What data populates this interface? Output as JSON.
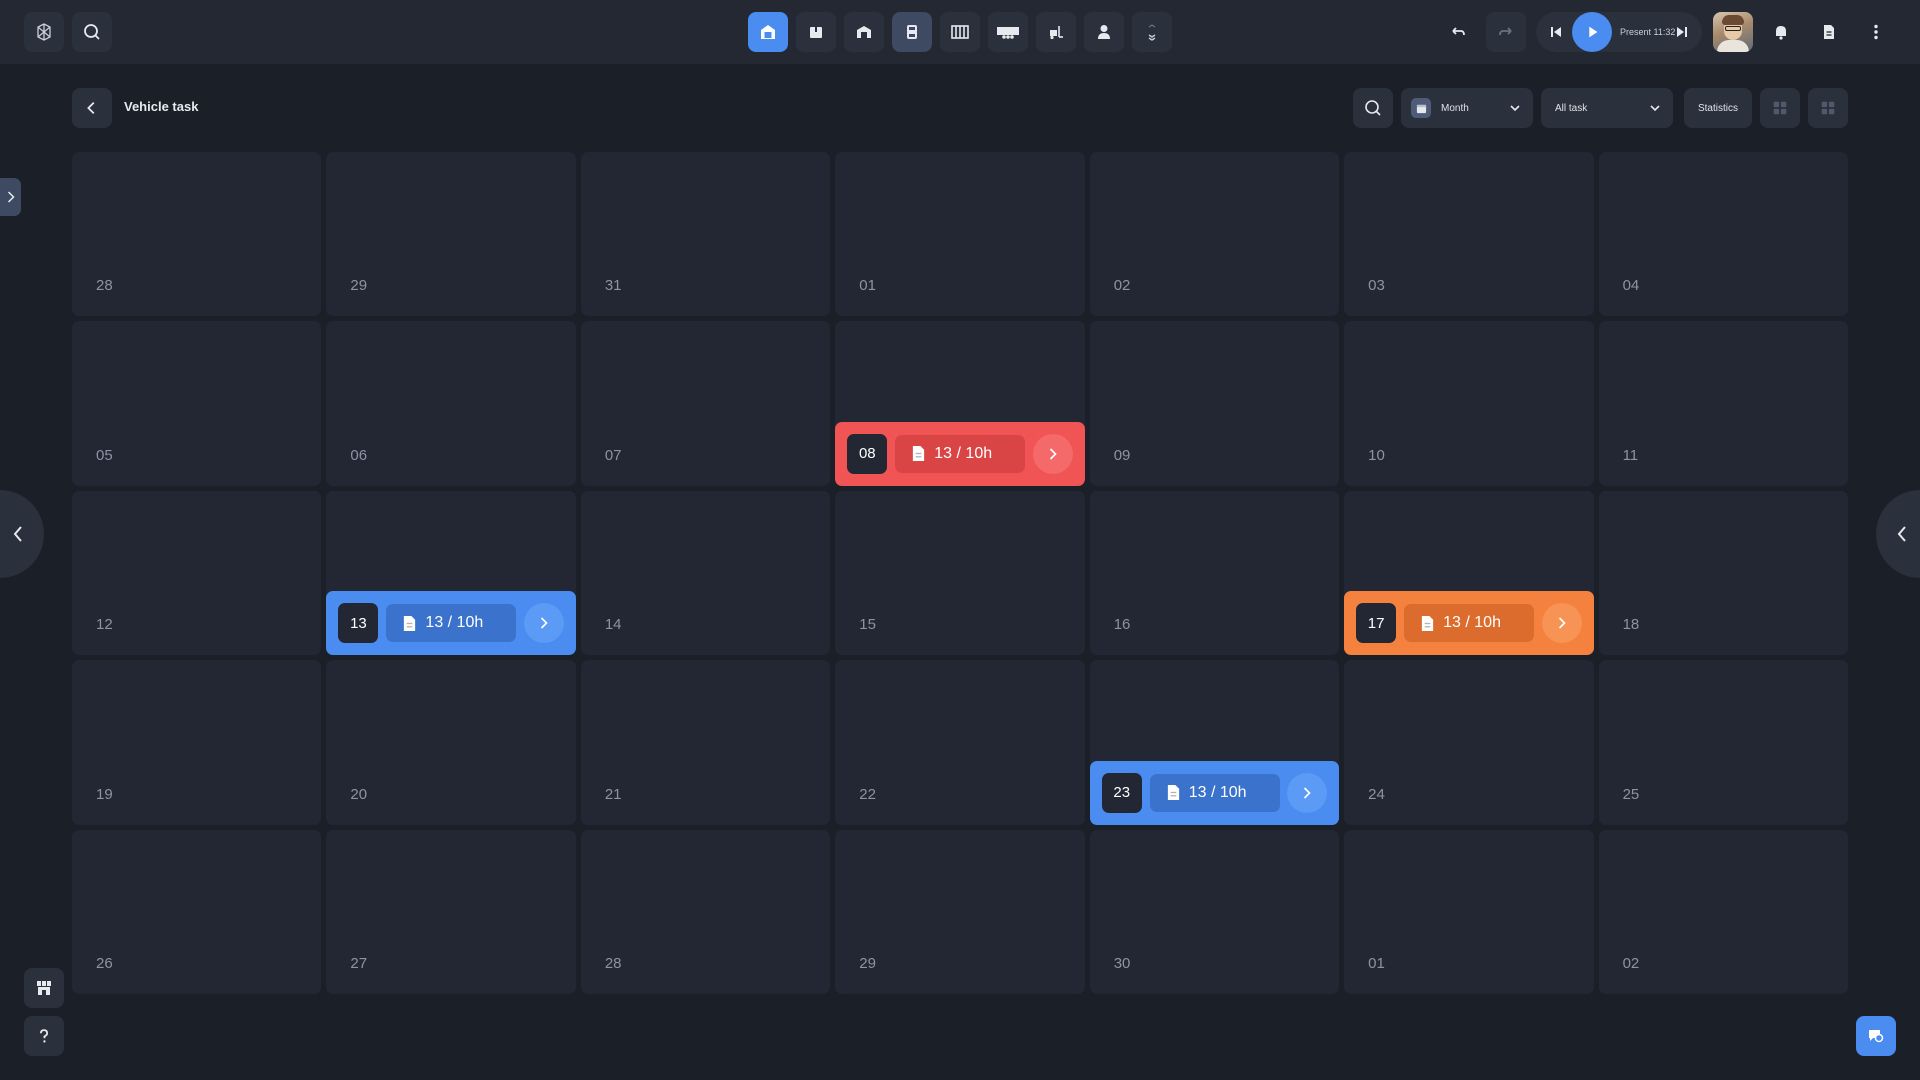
{
  "toolbar": {
    "present_label": "Present 11:32"
  },
  "header": {
    "title": "Vehicle task",
    "view_select": "Month",
    "filter_select": "All task",
    "statistics_label": "Statistics"
  },
  "calendar": {
    "days": [
      "28",
      "29",
      "31",
      "01",
      "02",
      "03",
      "04",
      "05",
      "06",
      "07",
      "08",
      "09",
      "10",
      "11",
      "12",
      "13",
      "14",
      "15",
      "16",
      "17",
      "18",
      "19",
      "20",
      "21",
      "22",
      "23",
      "24",
      "25",
      "26",
      "27",
      "28",
      "29",
      "30",
      "01",
      "02"
    ],
    "tasks": [
      {
        "day": "08",
        "summary": "13 / 10h",
        "color": "#f05454"
      },
      {
        "day": "13",
        "summary": "13 / 10h",
        "color": "#4a8cf0"
      },
      {
        "day": "17",
        "summary": "13 / 10h",
        "color": "#f5813f"
      },
      {
        "day": "23",
        "summary": "13 / 10h",
        "color": "#4a8cf0"
      }
    ]
  },
  "icons": {
    "toolbar": [
      "logo-icon",
      "search-icon",
      "garage-icon",
      "box-icon",
      "warehouse-icon",
      "vehicle-icon",
      "rack-icon",
      "truck-icon",
      "forklift-icon",
      "person-icon",
      "expand-icon",
      "undo-icon",
      "redo-icon",
      "skip-back-icon",
      "play-icon",
      "skip-forward-icon",
      "bell-icon",
      "document-icon",
      "more-icon"
    ]
  },
  "colors": {
    "accent": "#4a8cf0",
    "task_red": "#f05454",
    "task_orange": "#f5813f",
    "background": "#1b1f27"
  }
}
